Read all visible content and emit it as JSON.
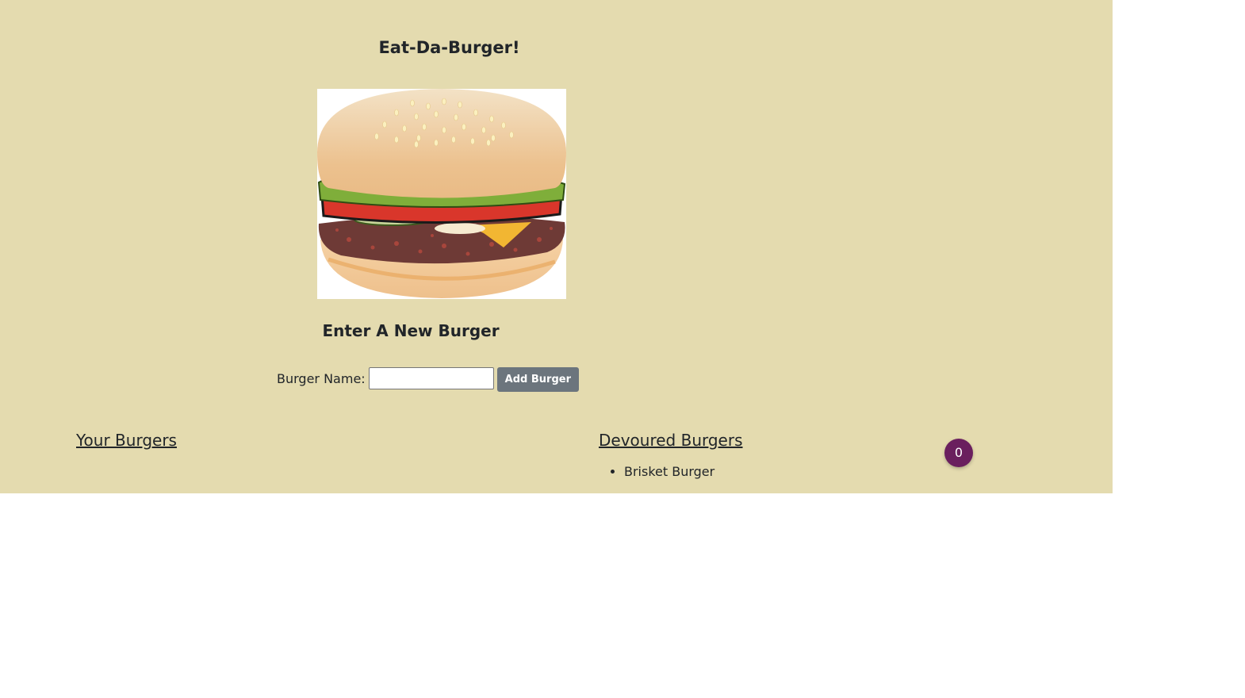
{
  "header": {
    "title": "Eat-Da-Burger!"
  },
  "hero_image": {
    "icon": "hamburger-image"
  },
  "form": {
    "heading": "Enter A New Burger",
    "label": "Burger Name:",
    "input_value": "",
    "input_placeholder": "",
    "submit_label": "Add Burger"
  },
  "your_burgers": {
    "heading": "Your Burgers",
    "items": []
  },
  "devoured_burgers": {
    "heading": "Devoured Burgers",
    "items": [
      "Brisket Burger"
    ]
  },
  "counter_badge": {
    "value": "0"
  },
  "colors": {
    "background": "#e4dbaf",
    "button": "#6c757d",
    "badge": "#6a1f5e"
  }
}
